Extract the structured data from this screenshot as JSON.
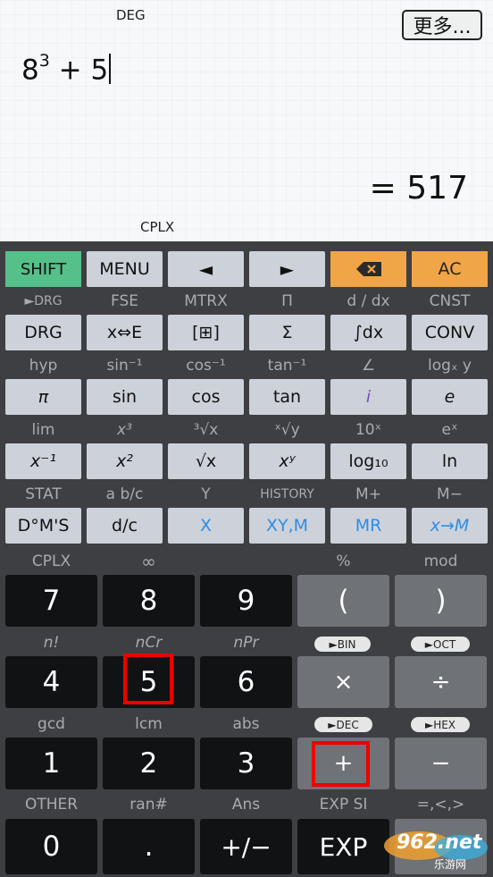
{
  "display": {
    "angle_mode": "DEG",
    "more_button": "更多...",
    "expr_base": "8",
    "expr_exp": "3",
    "expr_rest": " + 5",
    "result": "= 517",
    "complex_indicator": "CPLX"
  },
  "row1": {
    "shift": "SHIFT",
    "menu": "MENU",
    "left": "◄",
    "right": "►",
    "backspace": "⌫",
    "ac": "AC"
  },
  "labels2": [
    "►DRG",
    "FSE",
    "MTRX",
    "Π",
    "d / dx",
    "CNST"
  ],
  "row2": [
    "DRG",
    "x⇔E",
    "[⊞]",
    "Σ",
    "∫dx",
    "CONV"
  ],
  "labels3": [
    "hyp",
    "sin⁻¹",
    "cos⁻¹",
    "tan⁻¹",
    "∠",
    "logₓ y"
  ],
  "row3": [
    "π",
    "sin",
    "cos",
    "tan",
    "i",
    "e"
  ],
  "labels4": [
    "lim",
    "x³",
    "³√x",
    "ˣ√y",
    "10ˣ",
    "eˣ"
  ],
  "row4": [
    "x⁻¹",
    "x²",
    "√x",
    "xʸ",
    "log₁₀",
    "ln"
  ],
  "labels5": [
    "STAT",
    "a b/c",
    "Y",
    "HISTORY",
    "M+",
    "M−"
  ],
  "row5": [
    "D°M'S",
    "d/c",
    "X",
    "XY,M",
    "MR",
    "x→M"
  ],
  "labels6": [
    "CPLX",
    "∞",
    "",
    "%",
    "mod"
  ],
  "row6": [
    "7",
    "8",
    "9",
    "(",
    ")"
  ],
  "labels7": [
    "n!",
    "nCr",
    "nPr"
  ],
  "pills7": [
    "►BIN",
    "►OCT"
  ],
  "row7": [
    "4",
    "5",
    "6",
    "×",
    "÷"
  ],
  "labels8": [
    "gcd",
    "lcm",
    "abs"
  ],
  "pills8": [
    "►DEC",
    "►HEX"
  ],
  "row8": [
    "1",
    "2",
    "3",
    "+",
    "−"
  ],
  "labels9": [
    "OTHER",
    "ran#",
    "Ans",
    "EXP SI",
    "=,<,>"
  ],
  "row9": [
    "0",
    ".",
    "+/−",
    "EXP"
  ],
  "watermark": {
    "text": "962.net",
    "sub": "乐游网"
  }
}
